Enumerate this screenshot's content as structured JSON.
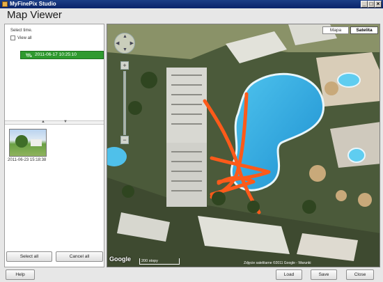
{
  "app": {
    "window_title": "MyFinePix Studio",
    "heading": "Map Viewer",
    "window_controls": {
      "minimize": "_",
      "maximize": "□",
      "close": "×"
    }
  },
  "left_panel": {
    "select_time_label": "Select time.",
    "view_all_label": "View all",
    "view_all_checked": false,
    "time_items": [
      {
        "label": "2011-06-17 10:25:10",
        "selected": true
      }
    ],
    "thumbnails": [
      {
        "date": "2011-06-23 15:18:38"
      }
    ],
    "select_all_label": "Select all",
    "cancel_all_label": "Cancel all"
  },
  "map": {
    "type_buttons": [
      {
        "label": "Mapa",
        "active": false
      },
      {
        "label": "Satelita",
        "active": true
      }
    ],
    "zoom_in": "+",
    "zoom_out": "−",
    "scale_label": "200 stopy",
    "attribution": "Zdjęcie satelitarne ©2011 Google - Warunki",
    "logo": "Google"
  },
  "bottom": {
    "help_label": "Help",
    "load_label": "Load",
    "save_label": "Save",
    "close_label": "Close"
  },
  "colors": {
    "accent": "#2f9a2f",
    "title_bar": "#0a246a",
    "path": "#ff5a1a"
  }
}
